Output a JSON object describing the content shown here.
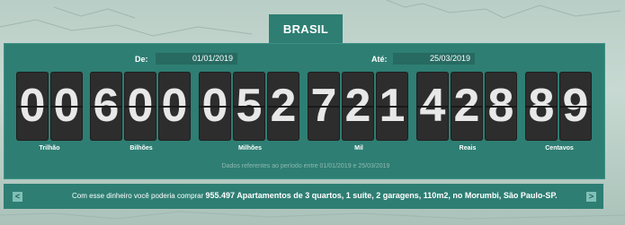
{
  "tab_title": "BRASIL",
  "date_from": {
    "label": "De:",
    "value": "01/01/2019"
  },
  "date_to": {
    "label": "Até:",
    "value": "25/03/2019"
  },
  "counter_digits": [
    "0",
    "0",
    "6",
    "0",
    "0",
    "0",
    "5",
    "2",
    "7",
    "2",
    "1",
    "4",
    "2",
    "8",
    "8",
    "9"
  ],
  "unit_labels": {
    "trilhao": "Trilhão",
    "bilhoes": "Bilhões",
    "milhoes": "Milhões",
    "mil": "Mil",
    "reais": "Reais",
    "centavos": "Centavos"
  },
  "period_note": "Dados referentes ao período entre 01/01/2019 e 25/03/2019",
  "ticker": {
    "prefix": "Com esse dinheiro você poderia comprar",
    "highlight": "955.497 Apartamentos de 3 quartos, 1 suíte, 2 garagens, 110m2, no Morumbi, São Paulo-SP.",
    "prev_icon": "<",
    "next_icon": ">"
  },
  "colors": {
    "panel": "#2e7e73",
    "digit_bg": "#2d2d2d",
    "digit_fg": "#e8e8e8"
  }
}
